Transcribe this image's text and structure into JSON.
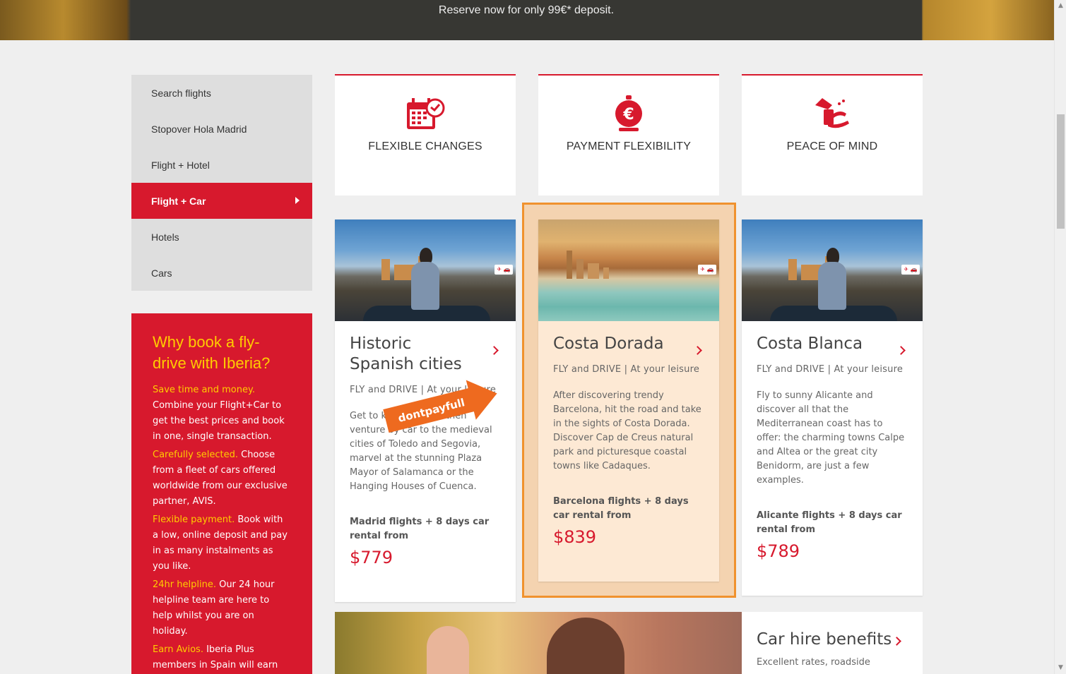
{
  "banner": {
    "text": "Reserve now for only 99€* deposit."
  },
  "nav": {
    "items": [
      {
        "label": "Search flights"
      },
      {
        "label": "Stopover Hola Madrid"
      },
      {
        "label": "Flight + Hotel"
      },
      {
        "label": "Flight + Car",
        "active": true
      },
      {
        "label": "Hotels"
      },
      {
        "label": "Cars"
      }
    ]
  },
  "why": {
    "title": "Why book a fly-drive with Iberia?",
    "points": [
      {
        "highlight": "Save time and money.",
        "text": " Combine your Flight+Car to get the best prices and book in one, single transaction."
      },
      {
        "highlight": "Carefully selected.",
        "text": " Choose from a fleet of cars offered worldwide from our exclusive partner, AVIS."
      },
      {
        "highlight": "Flexible payment.",
        "text": " Book with a low, online deposit and pay in as many instalments as you like."
      },
      {
        "highlight": "24hr helpline.",
        "text": " Our 24 hour helpline team are here to help whilst you are on holiday."
      },
      {
        "highlight": "Earn Avios.",
        "text": " Iberia Plus members in Spain will earn"
      }
    ]
  },
  "features": [
    {
      "label": "FLEXIBLE CHANGES",
      "icon": "calendar-icon"
    },
    {
      "label": "PAYMENT FLEXIBILITY",
      "icon": "euro-bag-icon"
    },
    {
      "label": "PEACE OF MIND",
      "icon": "hand-protection-icon"
    }
  ],
  "cards": [
    {
      "title": "Historic Spanish cities",
      "subtitle": "FLY and DRIVE  |  At your leisure",
      "description": "Get to know Madrid, then venture by car to the medieval cities of Toledo and Segovia, marvel at the stunning Plaza Mayor of Salamanca or the Hanging Houses of Cuenca.",
      "from": "Madrid flights + 8 days car rental from",
      "price": "$779"
    },
    {
      "title": "Costa Dorada",
      "subtitle": "FLY and DRIVE  |  At your leisure",
      "description": "After discovering trendy Barcelona, hit the road and take in the sights of Costa Dorada. Discover Cap de Creus natural park and picturesque coastal towns like Cadaques.",
      "from": "Barcelona flights + 8 days car rental from",
      "price": "$839"
    },
    {
      "title": "Costa Blanca",
      "subtitle": "FLY and DRIVE  |  At your leisure",
      "description": "Fly to sunny Alicante and discover all that the Mediterranean coast has to offer: the charming towns Calpe and Altea or the great city Benidorm, are just a few examples.",
      "from": "Alicante flights + 8 days car rental from",
      "price": "$789"
    }
  ],
  "badge_glyph": "✈ 🚗",
  "promo": {
    "label": "dontpayfull"
  },
  "benefits": {
    "title": "Car hire benefits",
    "text": "Excellent rates, roadside"
  },
  "colors": {
    "brand_red": "#d7192d",
    "highlight_yellow": "#ffcc00",
    "highlight_orange": "#f0922e"
  }
}
